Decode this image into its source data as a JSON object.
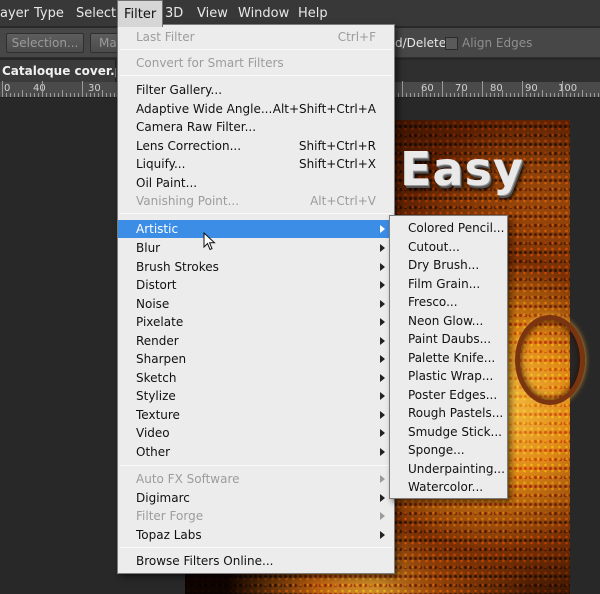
{
  "menubar": {
    "items": [
      {
        "label": "ayer",
        "name": "menu-layer"
      },
      {
        "label": "Type",
        "name": "menu-type"
      },
      {
        "label": "Select",
        "name": "menu-select"
      },
      {
        "label": "Filter",
        "name": "menu-filter",
        "active": true
      },
      {
        "label": "3D",
        "name": "menu-3d"
      },
      {
        "label": "View",
        "name": "menu-view"
      },
      {
        "label": "Window",
        "name": "menu-window"
      },
      {
        "label": "Help",
        "name": "menu-help"
      }
    ]
  },
  "options_bar": {
    "selection_button": "Selection...",
    "mask_button": "Ma",
    "add_delete_text": "d/Delete",
    "align_edges_label": "Align Edges"
  },
  "document": {
    "tab_title": "Cataloque cover.psd",
    "ruler_numbers": [
      "0",
      "40",
      "30",
      "60",
      "70",
      "80",
      "90",
      "100"
    ],
    "canvas_title": "Easy"
  },
  "filter_menu": {
    "groups": [
      [
        {
          "label": "Last Filter",
          "shortcut": "Ctrl+F",
          "disabled": true
        }
      ],
      [
        {
          "label": "Convert for Smart Filters",
          "disabled": true
        }
      ],
      [
        {
          "label": "Filter Gallery..."
        },
        {
          "label": "Adaptive Wide Angle...",
          "shortcut": "Alt+Shift+Ctrl+A"
        },
        {
          "label": "Camera Raw Filter..."
        },
        {
          "label": "Lens Correction...",
          "shortcut": "Shift+Ctrl+R"
        },
        {
          "label": "Liquify...",
          "shortcut": "Shift+Ctrl+X"
        },
        {
          "label": "Oil Paint..."
        },
        {
          "label": "Vanishing Point...",
          "shortcut": "Alt+Ctrl+V",
          "disabled": true
        }
      ],
      [
        {
          "label": "Artistic",
          "submenu": true,
          "highlighted": true
        },
        {
          "label": "Blur",
          "submenu": true
        },
        {
          "label": "Brush Strokes",
          "submenu": true
        },
        {
          "label": "Distort",
          "submenu": true
        },
        {
          "label": "Noise",
          "submenu": true
        },
        {
          "label": "Pixelate",
          "submenu": true
        },
        {
          "label": "Render",
          "submenu": true
        },
        {
          "label": "Sharpen",
          "submenu": true
        },
        {
          "label": "Sketch",
          "submenu": true
        },
        {
          "label": "Stylize",
          "submenu": true
        },
        {
          "label": "Texture",
          "submenu": true
        },
        {
          "label": "Video",
          "submenu": true
        },
        {
          "label": "Other",
          "submenu": true
        }
      ],
      [
        {
          "label": "Auto FX Software",
          "submenu": true,
          "disabled": true
        },
        {
          "label": "Digimarc",
          "submenu": true
        },
        {
          "label": "Filter Forge",
          "submenu": true,
          "disabled": true
        },
        {
          "label": "Topaz Labs",
          "submenu": true
        }
      ],
      [
        {
          "label": "Browse Filters Online..."
        }
      ]
    ]
  },
  "artistic_submenu": {
    "items": [
      "Colored Pencil...",
      "Cutout...",
      "Dry Brush...",
      "Film Grain...",
      "Fresco...",
      "Neon Glow...",
      "Paint Daubs...",
      "Palette Knife...",
      "Plastic Wrap...",
      "Poster Edges...",
      "Rough Pastels...",
      "Smudge Stick...",
      "Sponge...",
      "Underpainting...",
      "Watercolor..."
    ]
  },
  "colors": {
    "highlight": "#3b8de6",
    "menu_bg": "#ececec",
    "app_bg": "#282828"
  }
}
